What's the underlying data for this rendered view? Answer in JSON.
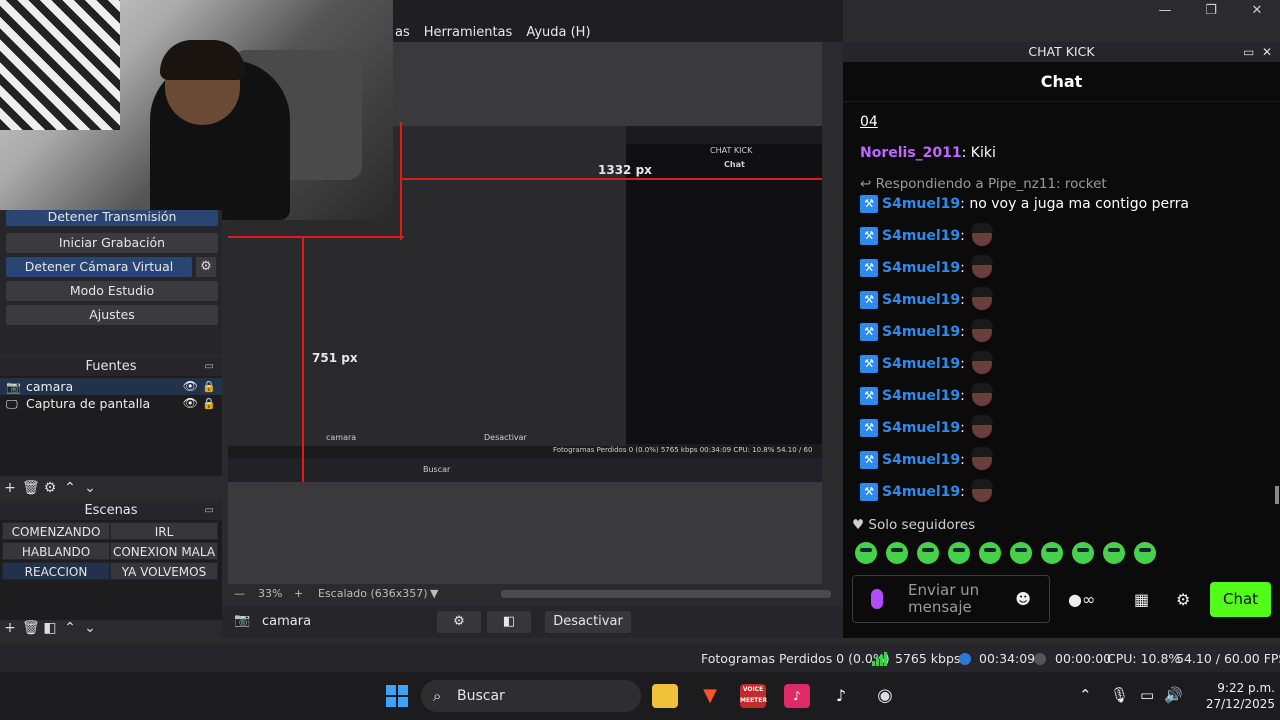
{
  "window": {
    "menu": [
      "as",
      "Herramientas",
      "Ayuda (H)"
    ],
    "controls": [
      "—",
      "❐",
      "✕"
    ]
  },
  "controls_dock": {
    "buttons": [
      "Detener Transmisión",
      "Iniciar Grabación",
      "Detener Cámara Virtual",
      "Modo Estudio",
      "Ajustes"
    ]
  },
  "sources": {
    "title": "Fuentes",
    "items": [
      "camara",
      "Captura de pantalla"
    ]
  },
  "scenes": {
    "title": "Escenas",
    "items": [
      "COMENZANDO",
      "IRL",
      "HABLANDO",
      "CONEXION MALA",
      "REACCION",
      "YA VOLVEMOS"
    ],
    "selected": "REACCION"
  },
  "preview": {
    "label_width": "1332 px",
    "label_height": "751 px",
    "thumb_chat_title": "CHAT KICK",
    "thumb_chat_head": "Chat",
    "thumb_search": "Buscar",
    "thumb_status": "Fotogramas Perdidos 0 (0.0%)   5765 kbps   00:34:09   CPU: 10.8%  54.10 / 60",
    "thumb_source": "camara",
    "thumb_deactivate": "Desactivar"
  },
  "zoom": {
    "value": "33%",
    "scale": "Escalado (636x357)"
  },
  "source_toolbar": {
    "name": "camara",
    "deactivate": "Desactivar"
  },
  "chat": {
    "dock_title": "CHAT KICK",
    "header": "Chat",
    "partial_link": "04",
    "msg1_user": "Norelis_2011",
    "msg1_text": ": Kiki",
    "reply_to": "Respondiendo a Pipe_nz11: rocket",
    "msg2_user": "S4muel19",
    "msg2_text": ": no voy a juga ma contigo perra",
    "emote_user": "S4muel19",
    "emote_count": 9,
    "followers_only": "Solo seguidores",
    "input_placeholder": "Enviar un mensaje",
    "send": "Chat"
  },
  "status": {
    "dropped": "Fotogramas Perdidos 0 (0.0%)",
    "bitrate": "5765 kbps",
    "live_time": "00:34:09",
    "rec_time": "00:00:00",
    "cpu": "CPU: 10.8%",
    "fps": "54.10 / 60.00 FPS"
  },
  "taskbar": {
    "search": "Buscar",
    "time": "9:22 p.m.",
    "date": "27/12/2025",
    "voice_label": "VOICE MEETER"
  },
  "colors": {
    "kick_green": "#53fc18",
    "mod_blue": "#2a8bf0",
    "user_purple": "#c266ff",
    "selection_blue": "#284573"
  }
}
